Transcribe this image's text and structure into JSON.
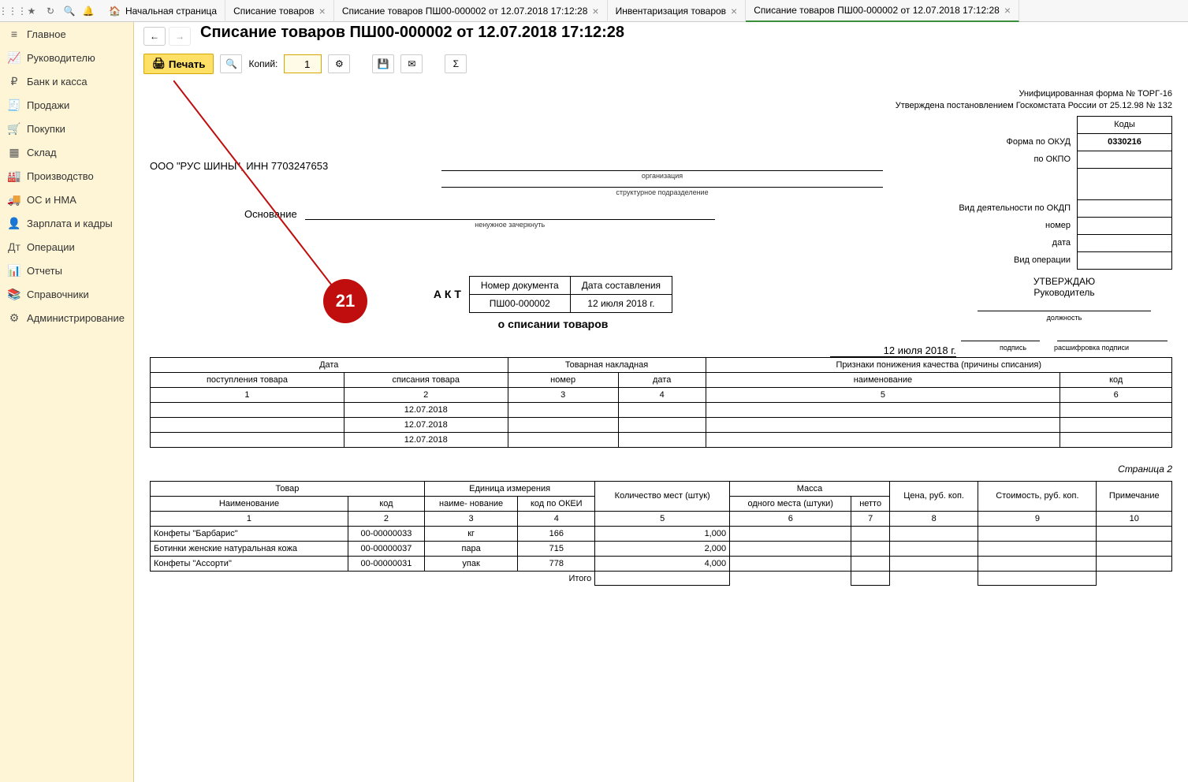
{
  "header": {
    "tabs": [
      {
        "label": "Начальная страница",
        "close": false,
        "home": true
      },
      {
        "label": "Списание товаров",
        "close": true
      },
      {
        "label": "Списание товаров ПШ00-000002 от 12.07.2018 17:12:28",
        "close": true
      },
      {
        "label": "Инвентаризация товаров",
        "close": true
      },
      {
        "label": "Списание товаров ПШ00-000002 от 12.07.2018 17:12:28",
        "close": true,
        "active": true
      }
    ]
  },
  "sidebar": {
    "items": [
      {
        "icon": "≡",
        "label": "Главное"
      },
      {
        "icon": "📈",
        "label": "Руководителю"
      },
      {
        "icon": "₽",
        "label": "Банк и касса"
      },
      {
        "icon": "🧾",
        "label": "Продажи"
      },
      {
        "icon": "🛒",
        "label": "Покупки"
      },
      {
        "icon": "▦",
        "label": "Склад"
      },
      {
        "icon": "🏭",
        "label": "Производство"
      },
      {
        "icon": "🚚",
        "label": "ОС и НМА"
      },
      {
        "icon": "👤",
        "label": "Зарплата и кадры"
      },
      {
        "icon": "Дт",
        "label": "Операции"
      },
      {
        "icon": "📊",
        "label": "Отчеты"
      },
      {
        "icon": "📚",
        "label": "Справочники"
      },
      {
        "icon": "⚙",
        "label": "Администрирование"
      }
    ]
  },
  "page": {
    "title": "Списание товаров ПШ00-000002 от 12.07.2018 17:12:28",
    "toolbar": {
      "print": "Печать",
      "copies_label": "Копий:",
      "copies_value": "1"
    }
  },
  "annotation": {
    "number": "21"
  },
  "form": {
    "unif": "Унифицированная форма № ТОРГ-16",
    "approved": "Утверждена постановлением Госкомстата России от 25.12.98 № 132",
    "codes_header": "Коды",
    "okud_label": "Форма по ОКУД",
    "okud_value": "0330216",
    "okpo_label": "по ОКПО",
    "okdp_label": "Вид деятельности по ОКДП",
    "number_label": "номер",
    "date_label": "дата",
    "op_label": "Вид операции",
    "org": "ООО \"РУС ШИНЫ\", ИНН 7703247653",
    "org_caption": "организация",
    "struct_caption": "структурное подразделение",
    "basis_label": "Основание",
    "basis_caption": "ненужное зачеркнуть",
    "approve": "УТВЕРЖДАЮ",
    "approve_role": "Руководитель",
    "approve_pos": "должность",
    "approve_sign": "подпись",
    "approve_decrypt": "расшифровка подписи",
    "act_label": "А К Т",
    "doc_num_head": "Номер документа",
    "doc_date_head": "Дата составления",
    "doc_num": "ПШ00-000002",
    "doc_date": "12 июля 2018 г.",
    "act_sub": "о списании товаров",
    "top_date": "12 июля 2018 г.",
    "page2": "Страница 2"
  },
  "table1": {
    "h_date": "Дата",
    "h_receipt": "поступления товара",
    "h_writeoff": "списания товара",
    "h_invoice": "Товарная накладная",
    "h_number": "номер",
    "h_idate": "дата",
    "h_reasons": "Признаки понижения качества (причины списания)",
    "h_name": "наименование",
    "h_code": "код",
    "rows": [
      {
        "d": "12.07.2018"
      },
      {
        "d": "12.07.2018"
      },
      {
        "d": "12.07.2018"
      }
    ]
  },
  "table2": {
    "h_goods": "Товар",
    "h_name": "Наименование",
    "h_code": "код",
    "h_unit": "Единица измерения",
    "h_unit_name": "наиме-\nнование",
    "h_unit_code": "код по ОКЕИ",
    "h_qty": "Количество мест (штук)",
    "h_mass": "Масса",
    "h_mass_one": "одного места (штуки)",
    "h_netto": "нетто",
    "h_price": "Цена, руб. коп.",
    "h_cost": "Стоимость, руб. коп.",
    "h_note": "Примечание",
    "total": "Итого",
    "rows": [
      {
        "name": "Конфеты \"Барбарис\"",
        "code": "00-00000033",
        "unit": "кг",
        "okei": "166",
        "qty": "1,000"
      },
      {
        "name": "Ботинки женские натуральная кожа",
        "code": "00-00000037",
        "unit": "пара",
        "okei": "715",
        "qty": "2,000"
      },
      {
        "name": "Конфеты \"Ассорти\"",
        "code": "00-00000031",
        "unit": "упак",
        "okei": "778",
        "qty": "4,000"
      }
    ]
  }
}
